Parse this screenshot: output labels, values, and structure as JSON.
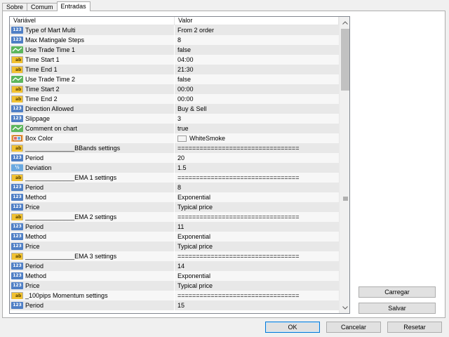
{
  "tabs": [
    {
      "label": "Sobre"
    },
    {
      "label": "Comum"
    },
    {
      "label": "Entradas",
      "active": true
    }
  ],
  "grid": {
    "columns": [
      "Variável",
      "Valor"
    ],
    "rows": [
      {
        "type": "int",
        "name": "Type of Mart Multi",
        "value": "From 2 order"
      },
      {
        "type": "int",
        "name": "Max Matingale Steps",
        "value": "8"
      },
      {
        "type": "bool",
        "name": "Use Trade Time 1",
        "value": "false"
      },
      {
        "type": "string",
        "name": "Time Start 1",
        "value": "04:00"
      },
      {
        "type": "string",
        "name": "Time End 1",
        "value": "21:30"
      },
      {
        "type": "bool",
        "name": "Use Trade Time 2",
        "value": "false"
      },
      {
        "type": "string",
        "name": "Time Start 2",
        "value": "00:00"
      },
      {
        "type": "string",
        "name": "Time End 2",
        "value": "00:00"
      },
      {
        "type": "int",
        "name": "Direction Allowed",
        "value": "Buy & Sell"
      },
      {
        "type": "int",
        "name": "Slippage",
        "value": "3"
      },
      {
        "type": "bool",
        "name": "Comment on chart",
        "value": "true"
      },
      {
        "type": "color",
        "name": "Box Color",
        "value": "WhiteSmoke"
      },
      {
        "type": "string",
        "name": "______________BBands settings",
        "value": "================================="
      },
      {
        "type": "int",
        "name": "Period",
        "value": "20"
      },
      {
        "type": "double",
        "name": "Deviation",
        "value": "1.5"
      },
      {
        "type": "string",
        "name": "______________EMA 1 settings",
        "value": "================================="
      },
      {
        "type": "int",
        "name": "Period",
        "value": "8"
      },
      {
        "type": "int",
        "name": "Method",
        "value": "Exponential"
      },
      {
        "type": "int",
        "name": "Price",
        "value": "Typical price"
      },
      {
        "type": "string",
        "name": "______________EMA 2 settings",
        "value": "================================="
      },
      {
        "type": "int",
        "name": "Period",
        "value": "11"
      },
      {
        "type": "int",
        "name": "Method",
        "value": "Exponential"
      },
      {
        "type": "int",
        "name": "Price",
        "value": "Typical price"
      },
      {
        "type": "string",
        "name": "______________EMA 3 settings",
        "value": "================================="
      },
      {
        "type": "int",
        "name": "Period",
        "value": "14"
      },
      {
        "type": "int",
        "name": "Method",
        "value": "Exponential"
      },
      {
        "type": "int",
        "name": "Price",
        "value": "Typical price"
      },
      {
        "type": "string",
        "name": "_100pips Momentum settings",
        "value": "================================="
      },
      {
        "type": "int",
        "name": "Period",
        "value": "15"
      }
    ]
  },
  "icons": {
    "int": {
      "name": "int-type-icon",
      "text": "123"
    },
    "string": {
      "name": "string-type-icon",
      "text": "ab"
    },
    "bool": {
      "name": "bool-type-icon",
      "text": ""
    },
    "double": {
      "name": "double-type-icon",
      "text": "½"
    },
    "color": {
      "name": "color-type-icon",
      "text": ""
    }
  },
  "buttons": {
    "load": "Carregar",
    "save": "Salvar",
    "ok": "OK",
    "cancel": "Cancelar",
    "reset": "Resetar"
  },
  "colors": {
    "row_odd": "#e8e8e8",
    "row_even": "#f7f7f7",
    "accent": "#0078d7"
  }
}
